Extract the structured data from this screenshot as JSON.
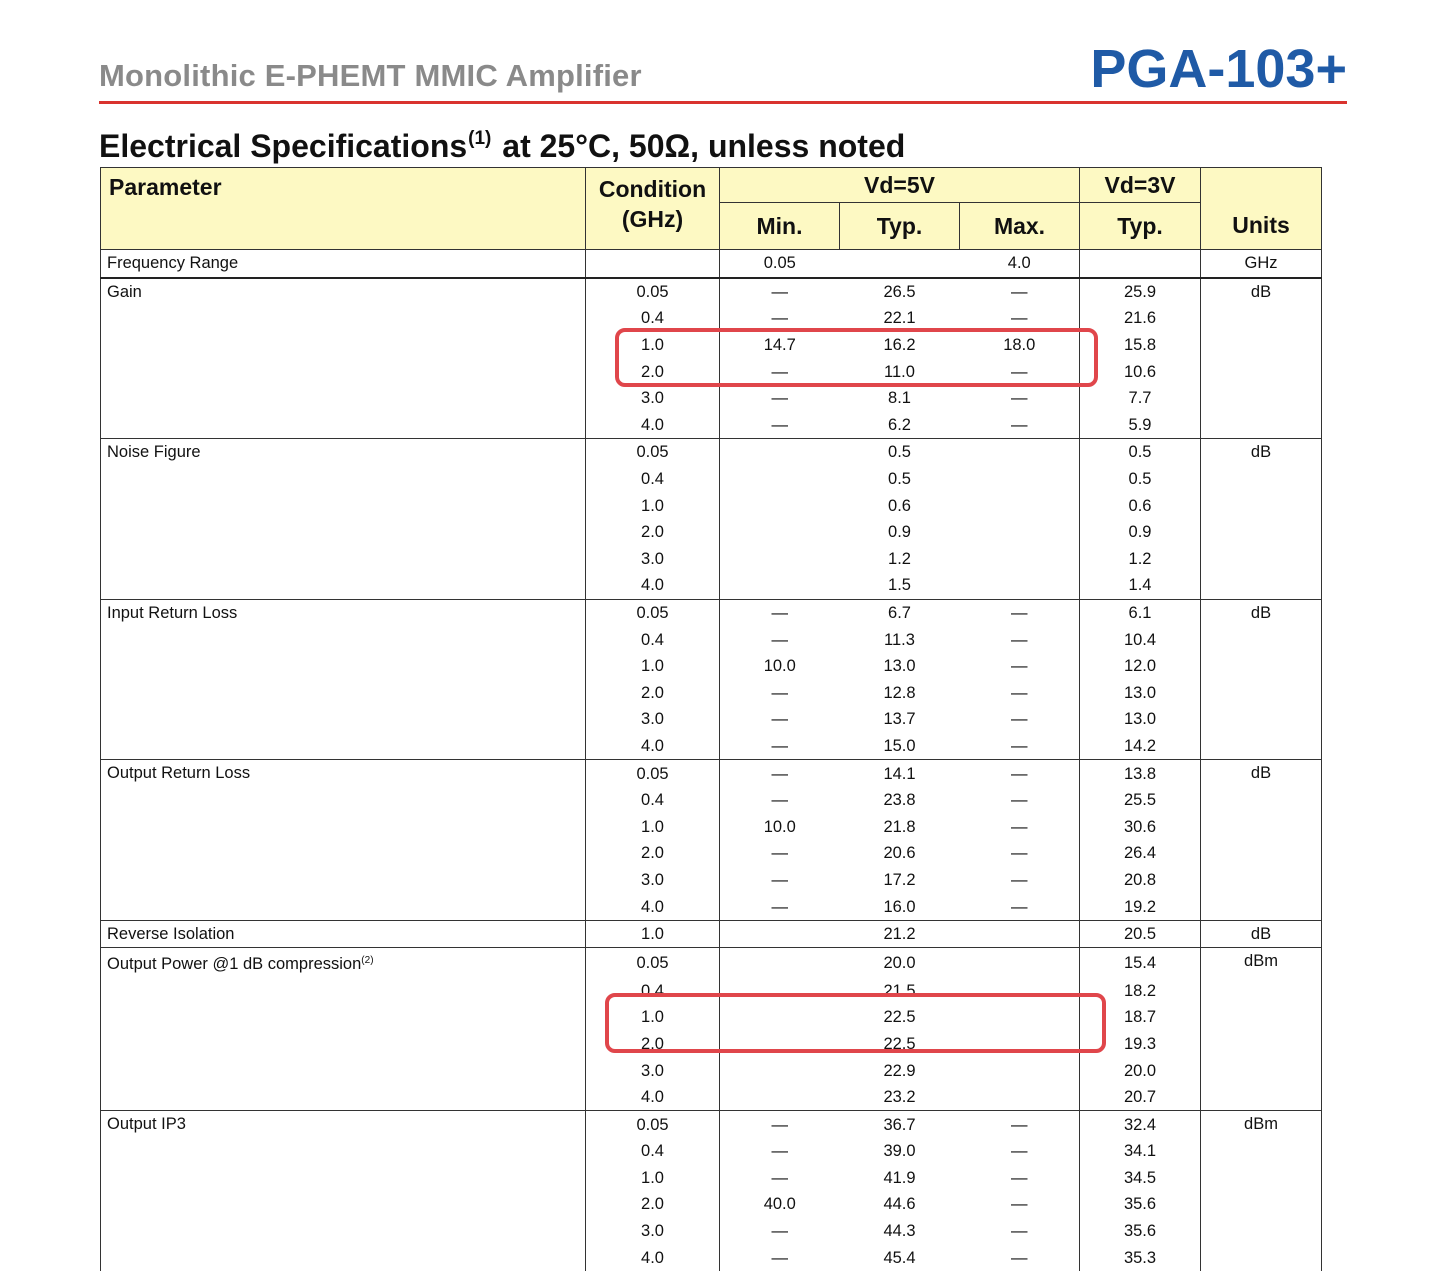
{
  "header": {
    "subtitle": "Monolithic E-PHEMT MMIC Amplifier",
    "part_number": "PGA-103+"
  },
  "section": {
    "title_main": "Electrical Specifications",
    "title_footnote": "(1)",
    "title_rest": " at 25°C, 50Ω, unless noted"
  },
  "columns": {
    "parameter": "Parameter",
    "condition_line1": "Condition",
    "condition_line2": "(GHz)",
    "vd5": "Vd=5V",
    "vd3": "Vd=3V",
    "min": "Min.",
    "typ5": "Typ.",
    "max": "Max.",
    "typ3": "Typ.",
    "units": "Units"
  },
  "frequency_range": {
    "parameter": "Frequency Range",
    "min": "0.05",
    "max": "4.0",
    "units": "GHz"
  },
  "groups": [
    {
      "parameter": "Gain",
      "footnote": "",
      "units": "dB",
      "highlight": [
        2,
        3
      ],
      "rows": [
        {
          "cond": "0.05",
          "min": "—",
          "typ5": "26.5",
          "max": "—",
          "typ3": "25.9"
        },
        {
          "cond": "0.4",
          "min": "—",
          "typ5": "22.1",
          "max": "—",
          "typ3": "21.6"
        },
        {
          "cond": "1.0",
          "min": "14.7",
          "typ5": "16.2",
          "max": "18.0",
          "typ3": "15.8"
        },
        {
          "cond": "2.0",
          "min": "—",
          "typ5": "11.0",
          "max": "—",
          "typ3": "10.6"
        },
        {
          "cond": "3.0",
          "min": "—",
          "typ5": "8.1",
          "max": "—",
          "typ3": "7.7"
        },
        {
          "cond": "4.0",
          "min": "—",
          "typ5": "6.2",
          "max": "—",
          "typ3": "5.9"
        }
      ]
    },
    {
      "parameter": "Noise Figure",
      "footnote": "",
      "units": "dB",
      "rows": [
        {
          "cond": "0.05",
          "min": "",
          "typ5": "0.5",
          "max": "",
          "typ3": "0.5"
        },
        {
          "cond": "0.4",
          "min": "",
          "typ5": "0.5",
          "max": "",
          "typ3": "0.5"
        },
        {
          "cond": "1.0",
          "min": "",
          "typ5": "0.6",
          "max": "",
          "typ3": "0.6"
        },
        {
          "cond": "2.0",
          "min": "",
          "typ5": "0.9",
          "max": "",
          "typ3": "0.9"
        },
        {
          "cond": "3.0",
          "min": "",
          "typ5": "1.2",
          "max": "",
          "typ3": "1.2"
        },
        {
          "cond": "4.0",
          "min": "",
          "typ5": "1.5",
          "max": "",
          "typ3": "1.4"
        }
      ]
    },
    {
      "parameter": "Input Return Loss",
      "footnote": "",
      "units": "dB",
      "rows": [
        {
          "cond": "0.05",
          "min": "—",
          "typ5": "6.7",
          "max": "—",
          "typ3": "6.1"
        },
        {
          "cond": "0.4",
          "min": "—",
          "typ5": "11.3",
          "max": "—",
          "typ3": "10.4"
        },
        {
          "cond": "1.0",
          "min": "10.0",
          "typ5": "13.0",
          "max": "—",
          "typ3": "12.0"
        },
        {
          "cond": "2.0",
          "min": "—",
          "typ5": "12.8",
          "max": "—",
          "typ3": "13.0"
        },
        {
          "cond": "3.0",
          "min": "—",
          "typ5": "13.7",
          "max": "—",
          "typ3": "13.0"
        },
        {
          "cond": "4.0",
          "min": "—",
          "typ5": "15.0",
          "max": "—",
          "typ3": "14.2"
        }
      ]
    },
    {
      "parameter": "Output Return Loss",
      "footnote": "",
      "units": "dB",
      "rows": [
        {
          "cond": "0.05",
          "min": "—",
          "typ5": "14.1",
          "max": "—",
          "typ3": "13.8"
        },
        {
          "cond": "0.4",
          "min": "—",
          "typ5": "23.8",
          "max": "—",
          "typ3": "25.5"
        },
        {
          "cond": "1.0",
          "min": "10.0",
          "typ5": "21.8",
          "max": "—",
          "typ3": "30.6"
        },
        {
          "cond": "2.0",
          "min": "—",
          "typ5": "20.6",
          "max": "—",
          "typ3": "26.4"
        },
        {
          "cond": "3.0",
          "min": "—",
          "typ5": "17.2",
          "max": "—",
          "typ3": "20.8"
        },
        {
          "cond": "4.0",
          "min": "—",
          "typ5": "16.0",
          "max": "—",
          "typ3": "19.2"
        }
      ]
    },
    {
      "parameter": "Reverse Isolation",
      "footnote": "",
      "units": "dB",
      "rows": [
        {
          "cond": "1.0",
          "min": "",
          "typ5": "21.2",
          "max": "",
          "typ3": "20.5"
        }
      ]
    },
    {
      "parameter": "Output Power @1 dB compression",
      "footnote": "(2)",
      "units": "dBm",
      "highlight": [
        2,
        3
      ],
      "rows": [
        {
          "cond": "0.05",
          "min": "",
          "typ5": "20.0",
          "max": "",
          "typ3": "15.4"
        },
        {
          "cond": "0.4",
          "min": "",
          "typ5": "21.5",
          "max": "",
          "typ3": "18.2"
        },
        {
          "cond": "1.0",
          "min": "",
          "typ5": "22.5",
          "max": "",
          "typ3": "18.7"
        },
        {
          "cond": "2.0",
          "min": "",
          "typ5": "22.5",
          "max": "",
          "typ3": "19.3"
        },
        {
          "cond": "3.0",
          "min": "",
          "typ5": "22.9",
          "max": "",
          "typ3": "20.0"
        },
        {
          "cond": "4.0",
          "min": "",
          "typ5": "23.2",
          "max": "",
          "typ3": "20.7"
        }
      ]
    },
    {
      "parameter": "Output IP3",
      "footnote": "",
      "units": "dBm",
      "rows": [
        {
          "cond": "0.05",
          "min": "—",
          "typ5": "36.7",
          "max": "—",
          "typ3": "32.4"
        },
        {
          "cond": "0.4",
          "min": "—",
          "typ5": "39.0",
          "max": "—",
          "typ3": "34.1"
        },
        {
          "cond": "1.0",
          "min": "—",
          "typ5": "41.9",
          "max": "—",
          "typ3": "34.5"
        },
        {
          "cond": "2.0",
          "min": "40.0",
          "typ5": "44.6",
          "max": "—",
          "typ3": "35.6"
        },
        {
          "cond": "3.0",
          "min": "—",
          "typ5": "44.3",
          "max": "—",
          "typ3": "35.6"
        },
        {
          "cond": "4.0",
          "min": "—",
          "typ5": "45.4",
          "max": "—",
          "typ3": "35.3"
        }
      ]
    }
  ]
}
